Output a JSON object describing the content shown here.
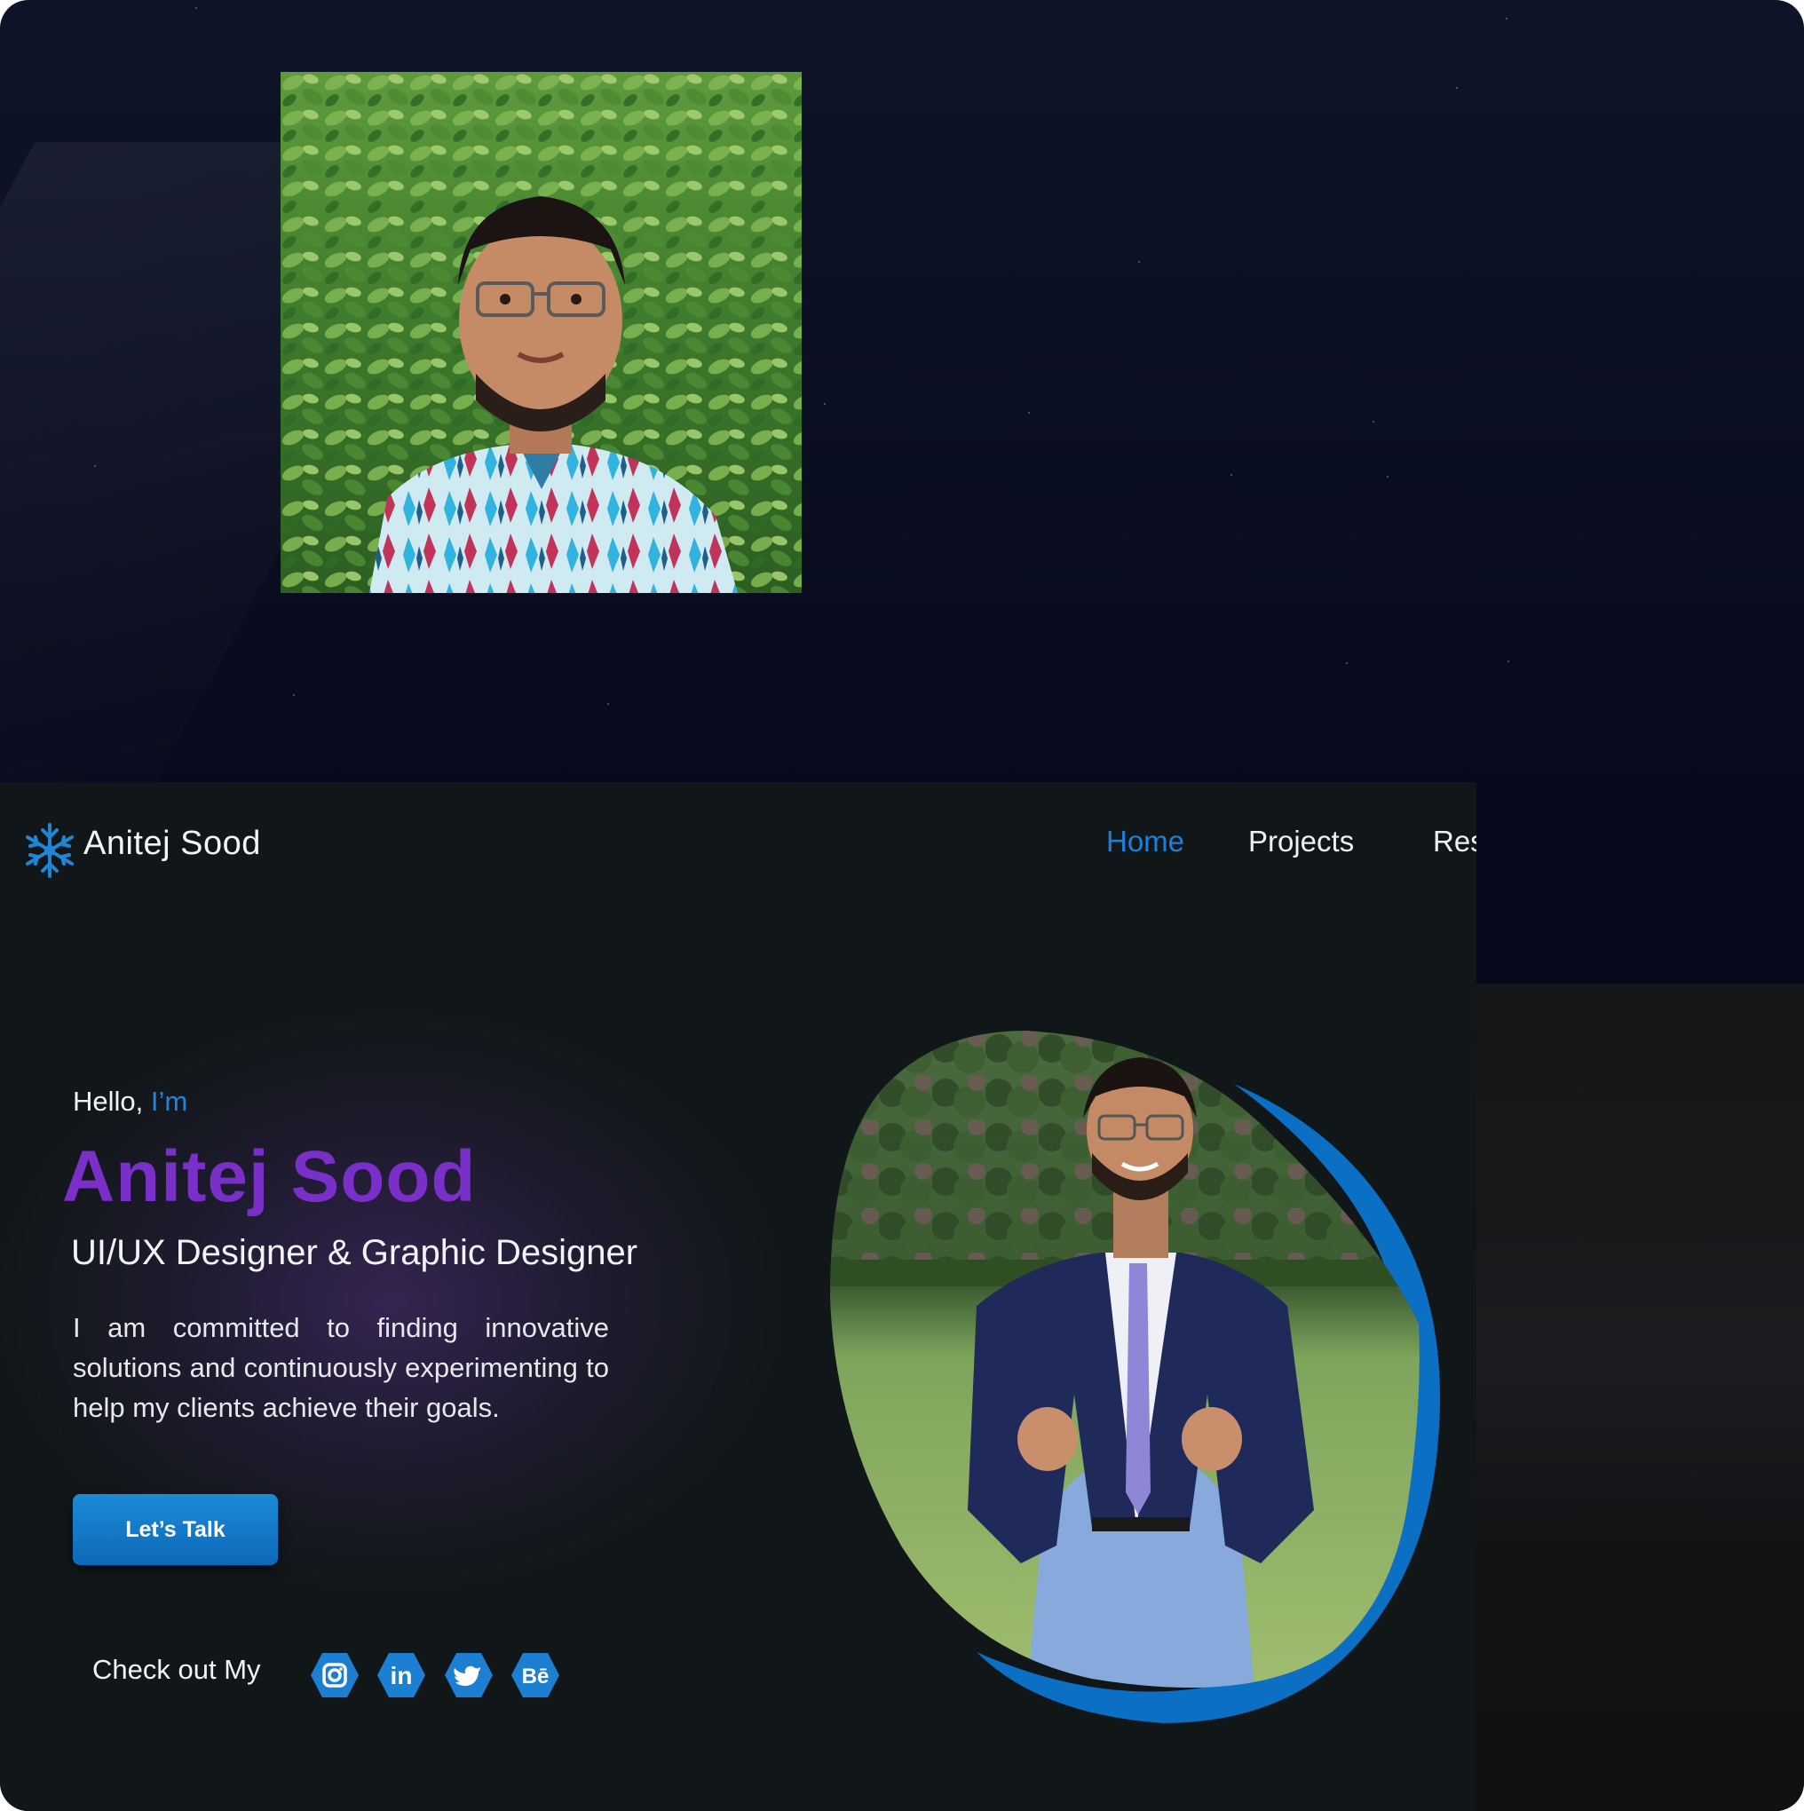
{
  "navbar": {
    "brand": "Anitej Sood",
    "links": [
      {
        "label": "Home",
        "active": true
      },
      {
        "label": "Projects",
        "active": false
      },
      {
        "label": "Res",
        "active": false
      }
    ]
  },
  "hero": {
    "greeting": "Hello,",
    "greeting_accent": "I’m",
    "name": "Anitej Sood",
    "role": "UI/UX Designer & Graphic Designer",
    "description": "I am committed to finding innovative solutions and continuously experimenting to help my clients achieve their goals.",
    "cta_label": "Let’s Talk",
    "social_label": "Check out My",
    "social_icons": [
      "instagram-icon",
      "linkedin-icon",
      "twitter-icon",
      "behance-icon"
    ],
    "social_glyphs": {
      "linkedin": "in",
      "behance": "Bē"
    }
  },
  "colors": {
    "accent_blue": "#1d7fd6",
    "name_purple": "#7a2fc9",
    "background": "#111718",
    "blob_blue": "#0b6fc3"
  }
}
